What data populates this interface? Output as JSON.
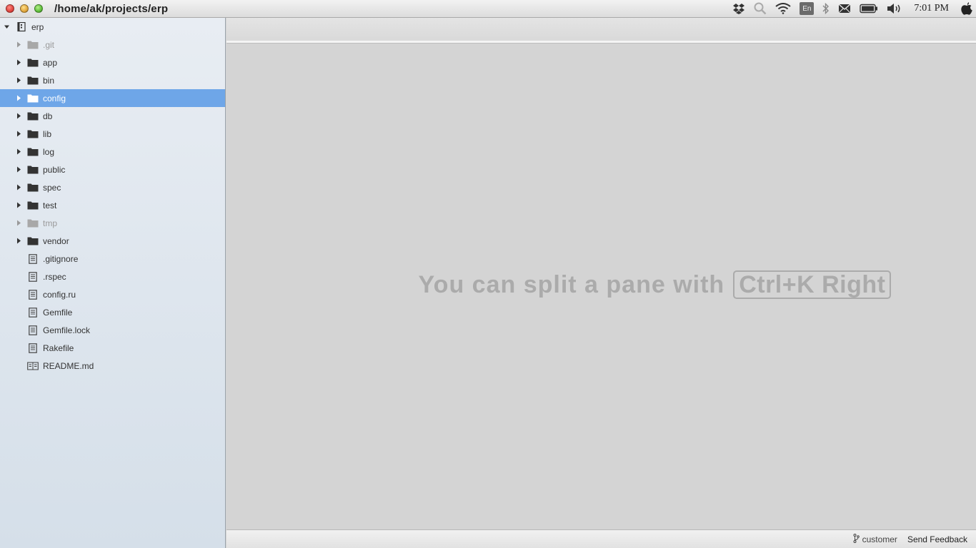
{
  "window": {
    "title": "/home/ak/projects/erp"
  },
  "tray": {
    "icons": [
      "dropbox-icon",
      "search-icon",
      "wifi-icon",
      "keyboard-layout-icon",
      "bluetooth-icon",
      "mail-icon",
      "battery-icon",
      "volume-icon",
      "apple-icon"
    ],
    "language": "En",
    "time": "7:01 PM"
  },
  "tree": {
    "root": "erp",
    "items": [
      {
        "label": ".git",
        "kind": "folder",
        "dim": true
      },
      {
        "label": "app",
        "kind": "folder"
      },
      {
        "label": "bin",
        "kind": "folder"
      },
      {
        "label": "config",
        "kind": "folder",
        "selected": true
      },
      {
        "label": "db",
        "kind": "folder"
      },
      {
        "label": "lib",
        "kind": "folder"
      },
      {
        "label": "log",
        "kind": "folder"
      },
      {
        "label": "public",
        "kind": "folder"
      },
      {
        "label": "spec",
        "kind": "folder"
      },
      {
        "label": "test",
        "kind": "folder"
      },
      {
        "label": "tmp",
        "kind": "folder",
        "dim": true
      },
      {
        "label": "vendor",
        "kind": "folder"
      },
      {
        "label": ".gitignore",
        "kind": "file"
      },
      {
        "label": ".rspec",
        "kind": "file"
      },
      {
        "label": "config.ru",
        "kind": "file"
      },
      {
        "label": "Gemfile",
        "kind": "file"
      },
      {
        "label": "Gemfile.lock",
        "kind": "file"
      },
      {
        "label": "Rakefile",
        "kind": "file"
      },
      {
        "label": "README.md",
        "kind": "readme"
      }
    ]
  },
  "editor": {
    "hint_text": "You can split a pane with",
    "hint_shortcut": "Ctrl+K Right"
  },
  "status": {
    "branch": "customer",
    "feedback": "Send Feedback"
  },
  "colors": {
    "selection": "#6ea6e8",
    "sidebar_top": "#e8edf3",
    "sidebar_bottom": "#d5dfe9",
    "pane_bg": "#d4d4d4",
    "hint": "#ababab"
  }
}
